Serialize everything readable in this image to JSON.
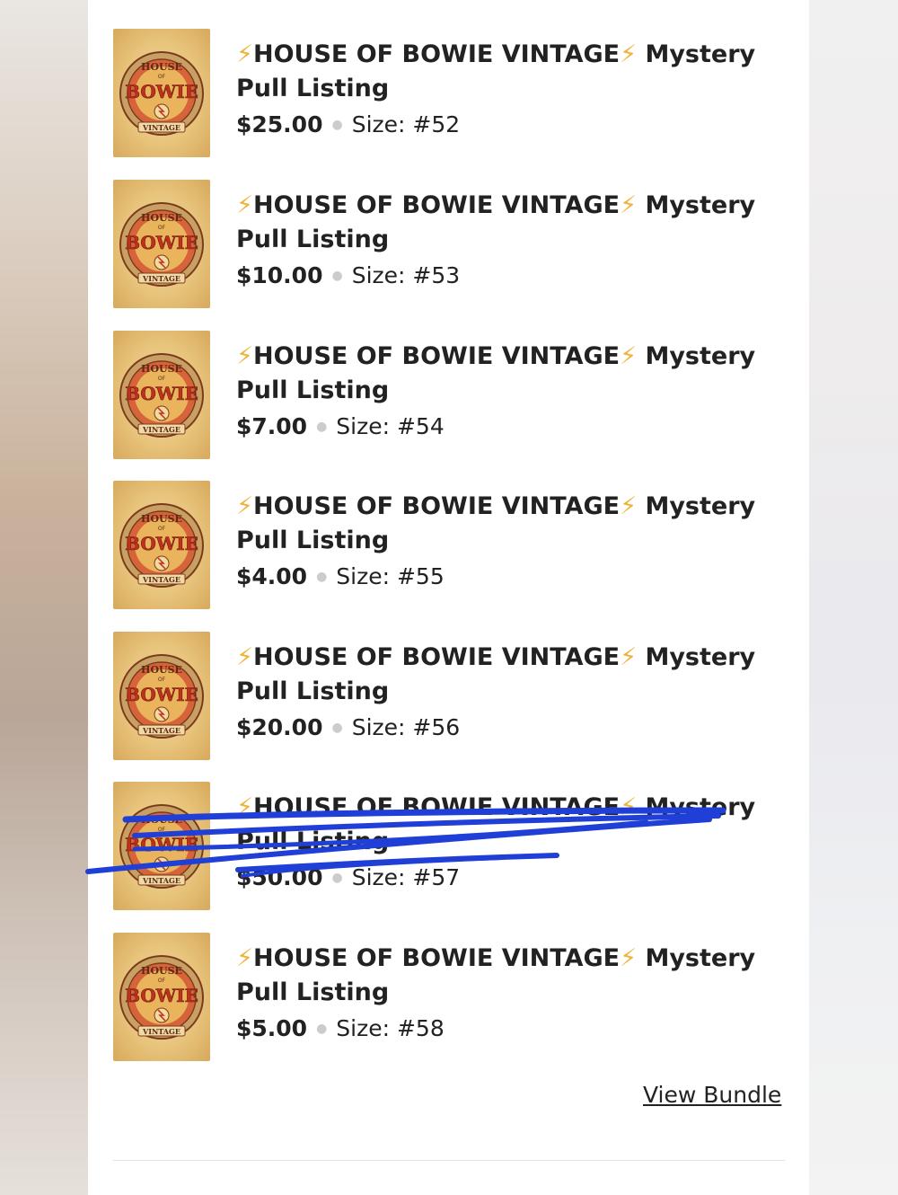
{
  "bundle": {
    "items": [
      {
        "title": "HOUSE OF BOWIE VINTAGE",
        "title_suffix": "Mystery Pull Listing",
        "price": "$25.00",
        "size": "Size: #52"
      },
      {
        "title": "HOUSE OF BOWIE VINTAGE",
        "title_suffix": "Mystery Pull Listing",
        "price": "$10.00",
        "size": "Size: #53"
      },
      {
        "title": "HOUSE OF BOWIE VINTAGE",
        "title_suffix": "Mystery Pull Listing",
        "price": "$7.00",
        "size": "Size: #54"
      },
      {
        "title": "HOUSE OF BOWIE VINTAGE",
        "title_suffix": "Mystery Pull Listing",
        "price": "$4.00",
        "size": "Size: #55"
      },
      {
        "title": "HOUSE OF BOWIE VINTAGE",
        "title_suffix": "Mystery Pull Listing",
        "price": "$20.00",
        "size": "Size: #56"
      },
      {
        "title": "HOUSE OF BOWIE VINTAGE",
        "title_suffix": "Mystery Pull Listing",
        "price": "$50.00",
        "size": "Size: #57",
        "scribbled_out": true
      },
      {
        "title": "HOUSE OF BOWIE VINTAGE",
        "title_suffix": "Mystery Pull Listing",
        "price": "$5.00",
        "size": "Size: #58"
      }
    ],
    "view_bundle_label": "View Bundle",
    "thumbnail": {
      "line1": "HOUSE",
      "line2": "OF",
      "line3": "BOWIE",
      "line4": "VINTAGE",
      "icon": "house-of-bowie-logo"
    }
  },
  "colors": {
    "bolt": "#f0b33a",
    "scribble": "#1f3fd6",
    "text": "#222222"
  }
}
